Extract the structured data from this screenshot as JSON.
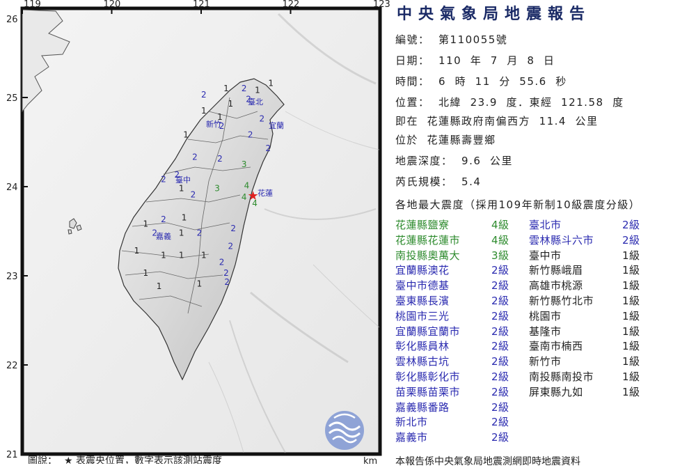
{
  "header": {
    "title": "中央氣象局地震報告"
  },
  "report": {
    "number": "編號：  第110055號",
    "date": "日期：  110  年  7  月  8  日",
    "time": "時間：  6  時  11  分  55.6  秒",
    "position": "位置：  北緯  23.9  度．東經  121.58  度",
    "relative": "即在  花蓮縣政府南偏西方  11.4  公里",
    "locality": "位於  花蓮縣壽豐鄉",
    "depth": "地震深度：  9.6  公里",
    "magnitude": "芮氏規模：  5.4",
    "intensity_heading": "各地最大震度（採用109年新制10級震度分級）"
  },
  "colors": {
    "level4": "#2e8b2e",
    "level3": "#2e8b2e",
    "level2": "#2b2bb0",
    "level1": "#222222",
    "epicenter": "#e02020",
    "title": "#1a2a66"
  },
  "intensities": {
    "left": [
      {
        "name": "花蓮縣鹽寮",
        "level": "4級",
        "cls": "level4"
      },
      {
        "name": "花蓮縣花蓮市",
        "level": "4級",
        "cls": "level4"
      },
      {
        "name": "南投縣奧萬大",
        "level": "3級",
        "cls": "level3"
      },
      {
        "name": "宜蘭縣澳花",
        "level": "2級",
        "cls": "level2"
      },
      {
        "name": "臺中市德基",
        "level": "2級",
        "cls": "level2"
      },
      {
        "name": "臺東縣長濱",
        "level": "2級",
        "cls": "level2"
      },
      {
        "name": "桃園市三光",
        "level": "2級",
        "cls": "level2"
      },
      {
        "name": "宜蘭縣宜蘭市",
        "level": "2級",
        "cls": "level2"
      },
      {
        "name": "彰化縣員林",
        "level": "2級",
        "cls": "level2"
      },
      {
        "name": "雲林縣古坑",
        "level": "2級",
        "cls": "level2"
      },
      {
        "name": "彰化縣彰化市",
        "level": "2級",
        "cls": "level2"
      },
      {
        "name": "苗栗縣苗栗市",
        "level": "2級",
        "cls": "level2"
      },
      {
        "name": "嘉義縣番路",
        "level": "2級",
        "cls": "level2"
      },
      {
        "name": "新北市",
        "level": "2級",
        "cls": "level2"
      },
      {
        "name": "嘉義市",
        "level": "2級",
        "cls": "level2"
      }
    ],
    "right": [
      {
        "name": "臺北市",
        "level": "2級",
        "cls": "level2"
      },
      {
        "name": "雲林縣斗六市",
        "level": "2級",
        "cls": "level2"
      },
      {
        "name": "臺中市",
        "level": "1級",
        "cls": "level1"
      },
      {
        "name": "新竹縣峨眉",
        "level": "1級",
        "cls": "level1"
      },
      {
        "name": "高雄市桃源",
        "level": "1級",
        "cls": "level1"
      },
      {
        "name": "新竹縣竹北市",
        "level": "1級",
        "cls": "level1"
      },
      {
        "name": "桃園市",
        "level": "1級",
        "cls": "level1"
      },
      {
        "name": "基隆市",
        "level": "1級",
        "cls": "level1"
      },
      {
        "name": "臺南市楠西",
        "level": "1級",
        "cls": "level1"
      },
      {
        "name": "新竹市",
        "level": "1級",
        "cls": "level1"
      },
      {
        "name": "南投縣南投市",
        "level": "1級",
        "cls": "level1"
      },
      {
        "name": "屏東縣九如",
        "level": "1級",
        "cls": "level1"
      }
    ]
  },
  "map": {
    "lon_ticks": [
      "119",
      "120",
      "121",
      "122",
      "123"
    ],
    "lat_ticks": [
      "26",
      "25",
      "24",
      "23",
      "22",
      "21"
    ],
    "city_labels": [
      "臺北",
      "新竹",
      "宜蘭",
      "臺中",
      "花蓮",
      "嘉義"
    ],
    "legend_text": "圖說：",
    "legend_epicenter": "★ 表震央位置，數字表示該測站震度",
    "scale_unit": "km",
    "stations": [
      {
        "v": "2",
        "lon": 121.45,
        "lat": 25.07,
        "cls": "level2"
      },
      {
        "v": "1",
        "lon": 121.25,
        "lat": 25.07,
        "cls": "level1"
      },
      {
        "v": "1",
        "lon": 121.6,
        "lat": 25.05,
        "cls": "level1"
      },
      {
        "v": "1",
        "lon": 121.75,
        "lat": 25.13,
        "cls": "level1"
      },
      {
        "v": "2",
        "lon": 121.5,
        "lat": 24.95,
        "cls": "level2"
      },
      {
        "v": "1",
        "lon": 121.3,
        "lat": 24.9,
        "cls": "level1"
      },
      {
        "v": "2",
        "lon": 121.0,
        "lat": 25.0,
        "cls": "level2"
      },
      {
        "v": "1",
        "lon": 121.0,
        "lat": 24.82,
        "cls": "level1"
      },
      {
        "v": "1",
        "lon": 121.18,
        "lat": 24.75,
        "cls": "level1"
      },
      {
        "v": "2",
        "lon": 121.2,
        "lat": 24.65,
        "cls": "level2"
      },
      {
        "v": "2",
        "lon": 121.65,
        "lat": 24.73,
        "cls": "level2"
      },
      {
        "v": "2",
        "lon": 121.52,
        "lat": 24.55,
        "cls": "level2"
      },
      {
        "v": "2",
        "lon": 121.72,
        "lat": 24.4,
        "cls": "level2"
      },
      {
        "v": "1",
        "lon": 120.8,
        "lat": 24.55,
        "cls": "level1"
      },
      {
        "v": "2",
        "lon": 120.9,
        "lat": 24.3,
        "cls": "level2"
      },
      {
        "v": "2",
        "lon": 121.18,
        "lat": 24.28,
        "cls": "level2"
      },
      {
        "v": "3",
        "lon": 121.45,
        "lat": 24.22,
        "cls": "level3"
      },
      {
        "v": "2",
        "lon": 120.7,
        "lat": 24.1,
        "cls": "level2"
      },
      {
        "v": "2",
        "lon": 120.55,
        "lat": 24.05,
        "cls": "level2"
      },
      {
        "v": "1",
        "lon": 120.75,
        "lat": 23.95,
        "cls": "level1"
      },
      {
        "v": "3",
        "lon": 121.15,
        "lat": 23.95,
        "cls": "level3"
      },
      {
        "v": "4",
        "lon": 121.48,
        "lat": 23.98,
        "cls": "level4"
      },
      {
        "v": "4",
        "lon": 121.57,
        "lat": 23.78,
        "cls": "level4"
      },
      {
        "v": "4",
        "lon": 121.45,
        "lat": 23.85,
        "cls": "level4"
      },
      {
        "v": "2",
        "lon": 120.88,
        "lat": 23.88,
        "cls": "level2"
      },
      {
        "v": "1",
        "lon": 120.78,
        "lat": 23.62,
        "cls": "level1"
      },
      {
        "v": "1",
        "lon": 120.35,
        "lat": 23.55,
        "cls": "level1"
      },
      {
        "v": "2",
        "lon": 120.55,
        "lat": 23.6,
        "cls": "level2"
      },
      {
        "v": "2",
        "lon": 120.45,
        "lat": 23.45,
        "cls": "level2"
      },
      {
        "v": "1",
        "lon": 120.75,
        "lat": 23.45,
        "cls": "level1"
      },
      {
        "v": "2",
        "lon": 120.95,
        "lat": 23.45,
        "cls": "level2"
      },
      {
        "v": "2",
        "lon": 121.33,
        "lat": 23.5,
        "cls": "level2"
      },
      {
        "v": "2",
        "lon": 121.3,
        "lat": 23.3,
        "cls": "level2"
      },
      {
        "v": "1",
        "lon": 120.25,
        "lat": 23.25,
        "cls": "level1"
      },
      {
        "v": "1",
        "lon": 120.55,
        "lat": 23.2,
        "cls": "level1"
      },
      {
        "v": "1",
        "lon": 120.75,
        "lat": 23.2,
        "cls": "level1"
      },
      {
        "v": "2",
        "lon": 121.2,
        "lat": 23.12,
        "cls": "level2"
      },
      {
        "v": "2",
        "lon": 121.25,
        "lat": 23.0,
        "cls": "level2"
      },
      {
        "v": "1",
        "lon": 121.0,
        "lat": 23.2,
        "cls": "level1"
      },
      {
        "v": "1",
        "lon": 120.35,
        "lat": 23.0,
        "cls": "level1"
      },
      {
        "v": "1",
        "lon": 120.5,
        "lat": 22.85,
        "cls": "level1"
      },
      {
        "v": "1",
        "lon": 120.95,
        "lat": 22.88,
        "cls": "level1"
      },
      {
        "v": "2",
        "lon": 121.26,
        "lat": 22.9,
        "cls": "level2"
      }
    ]
  },
  "footer": {
    "note": "本報告係中央氣象局地震測網即時地震資料"
  }
}
